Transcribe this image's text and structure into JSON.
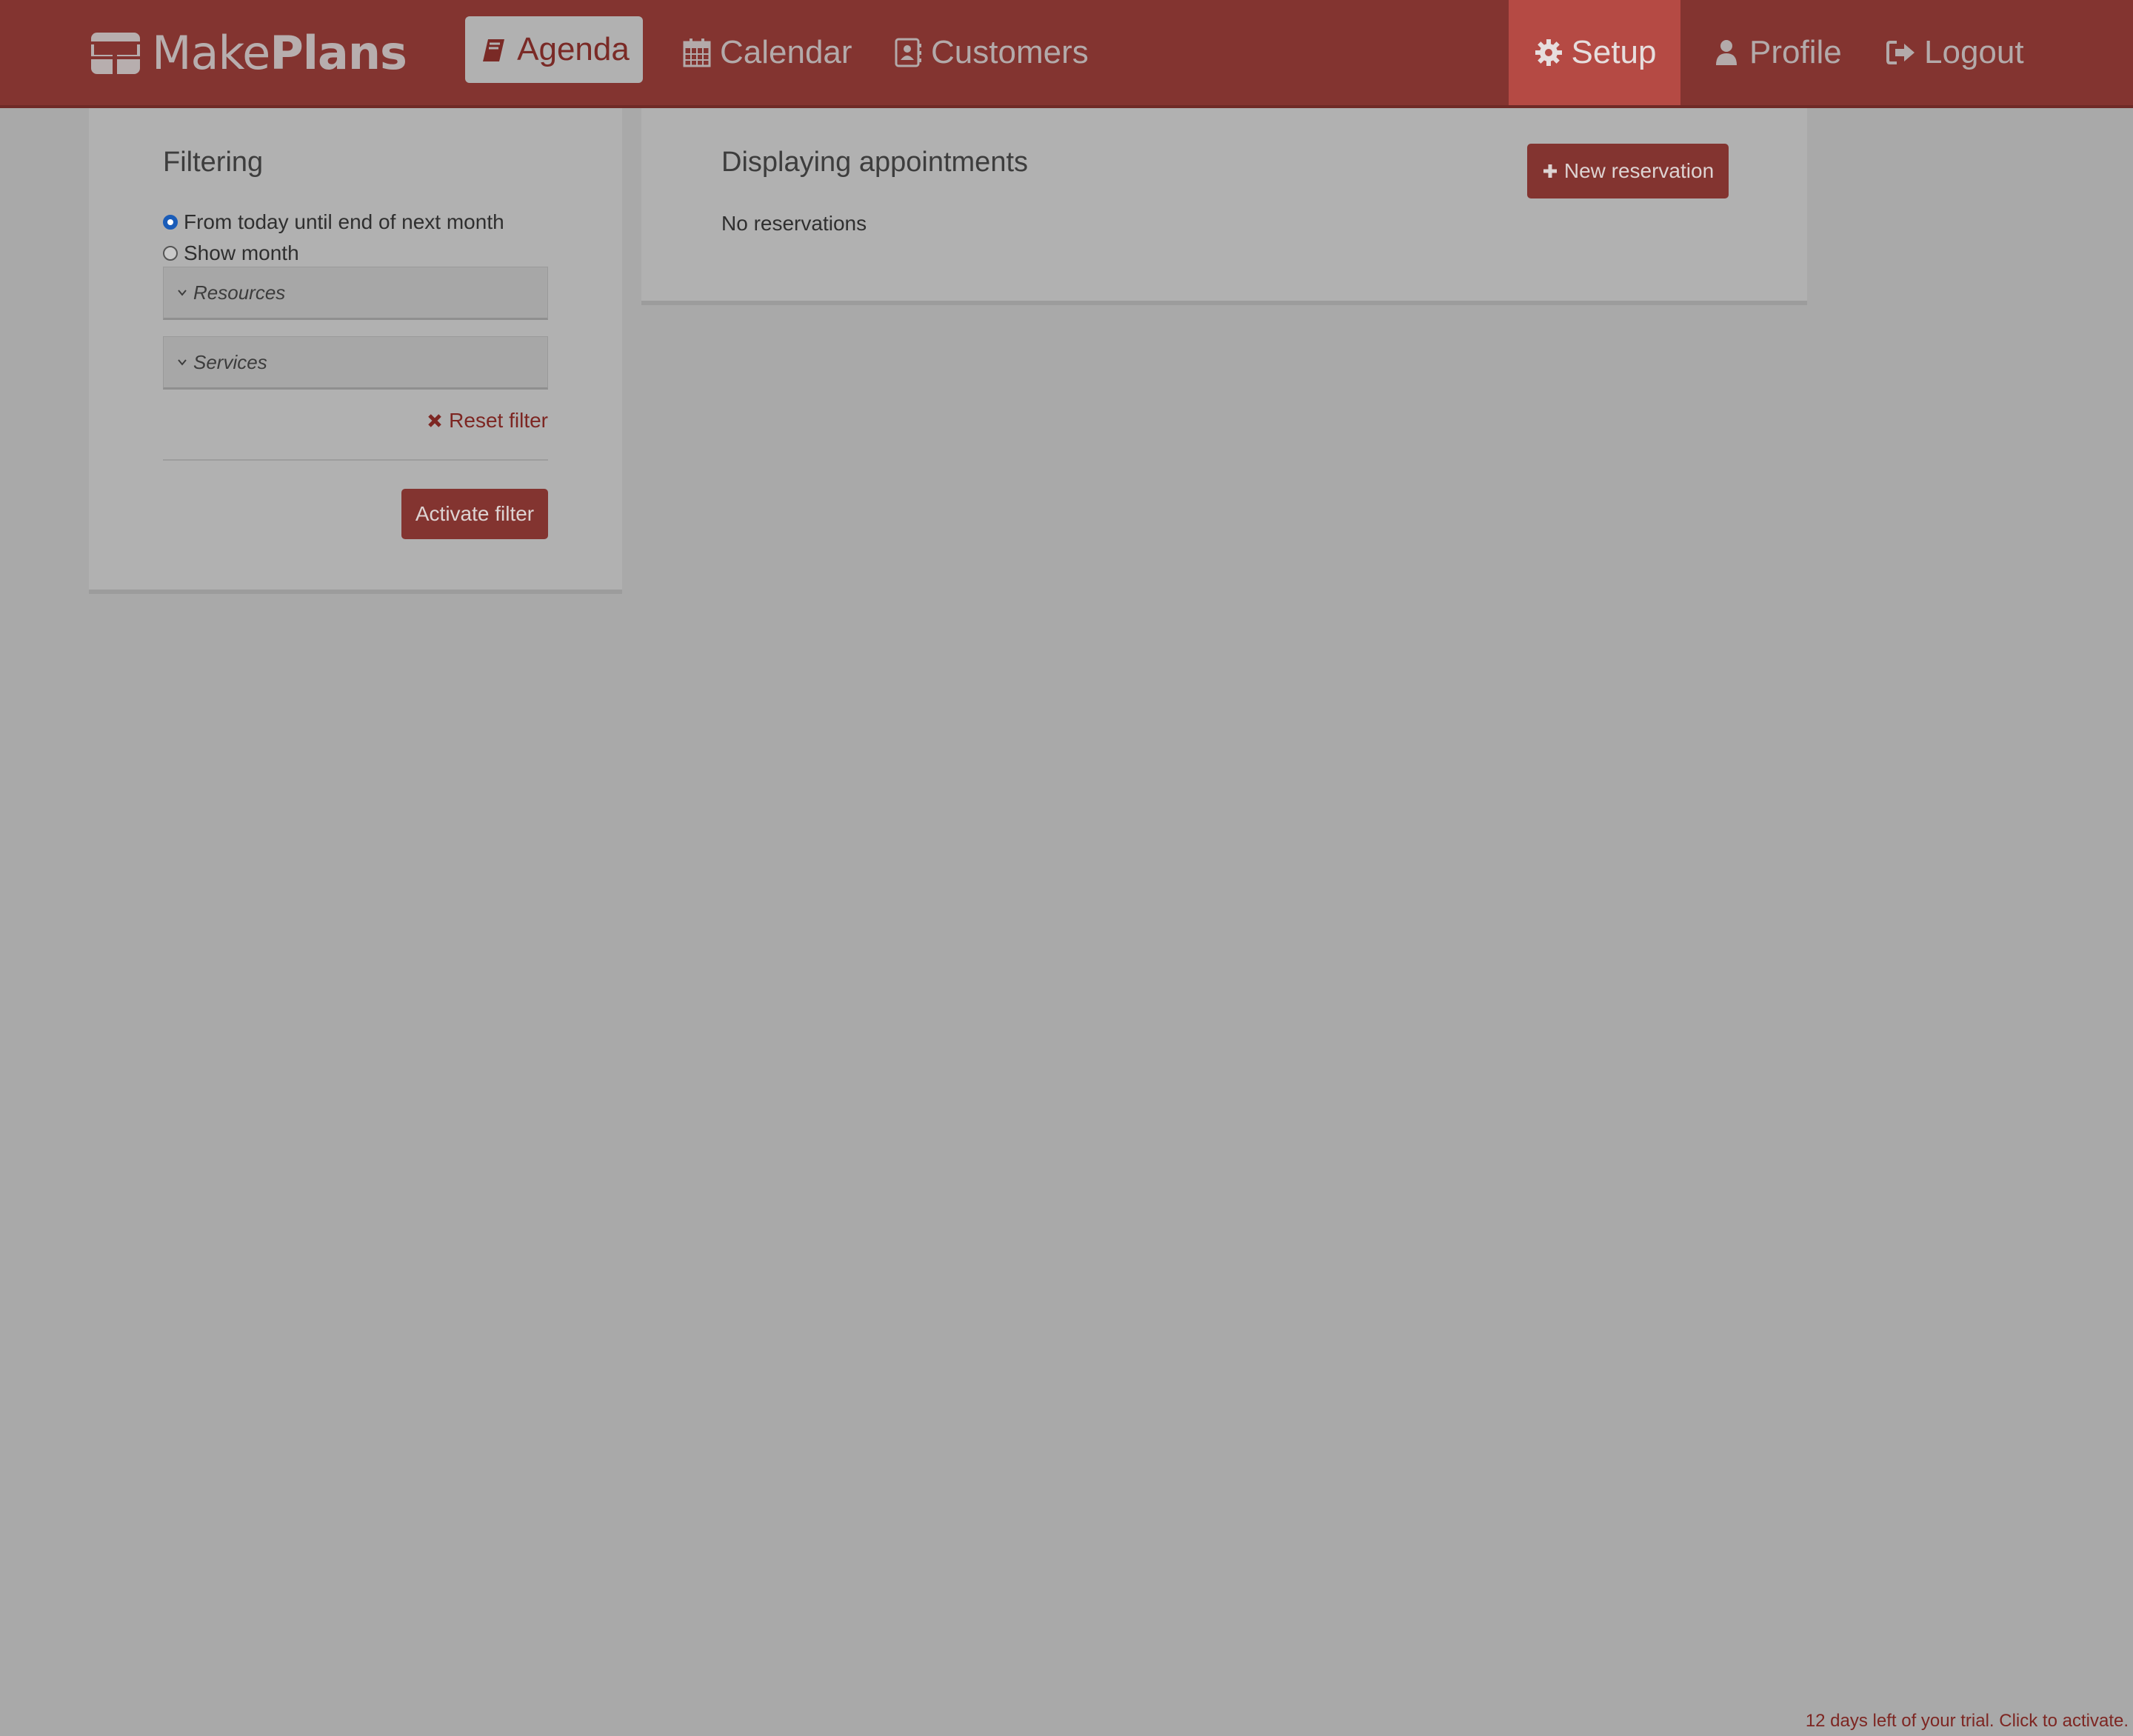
{
  "brand": {
    "name_light": "Make",
    "name_bold": "Plans",
    "icon": "table-grid-icon"
  },
  "nav": {
    "left": [
      {
        "label": "Agenda",
        "icon": "book-icon",
        "active": true
      },
      {
        "label": "Calendar",
        "icon": "calendar-icon"
      },
      {
        "label": "Customers",
        "icon": "contact-card-icon"
      }
    ],
    "right": [
      {
        "label": "Setup",
        "icon": "gear-icon",
        "highlight": true
      },
      {
        "label": "Profile",
        "icon": "user-icon"
      },
      {
        "label": "Logout",
        "icon": "logout-icon"
      }
    ]
  },
  "filter": {
    "title": "Filtering",
    "options": [
      {
        "label": "From today until end of next month",
        "checked": true
      },
      {
        "label": "Show month",
        "checked": false
      }
    ],
    "accordions": [
      {
        "label": "Resources"
      },
      {
        "label": "Services"
      }
    ],
    "reset_label": "Reset filter",
    "activate_label": "Activate filter"
  },
  "main": {
    "title": "Displaying appointments",
    "new_reservation_label": "New reservation",
    "empty_text": "No reservations"
  },
  "trial_notice": "12 days left of your trial. Click to activate.",
  "colors": {
    "brand": "#833430",
    "setup_highlight": "#b54a44",
    "overlay_background": "#a9a9a9"
  }
}
